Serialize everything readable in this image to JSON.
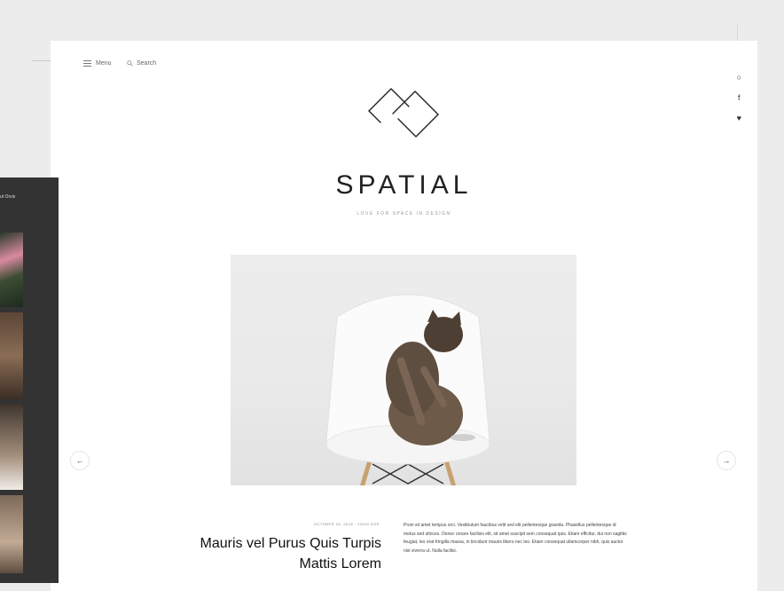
{
  "header": {
    "menu_label": "Menu",
    "search_label": "Search"
  },
  "social": {
    "items": [
      "github-icon",
      "facebook-icon",
      "twitter-icon"
    ],
    "glyphs": [
      "○",
      "f",
      "♥"
    ]
  },
  "brand": {
    "name": "SPATIAL",
    "tagline": "LOVE FOR SPACE IN DESIGN"
  },
  "slider": {
    "prev_glyph": "←",
    "next_glyph": "→"
  },
  "post": {
    "meta": "OCTOBER 16, 2018 · JOHN DOE",
    "title_line1": "Mauris vel Purus Quis Turpis",
    "title_line2": "Mattis Lorem",
    "body": "Proin sit amet tempus orci. Vestibulum faucibus velit sed elit pellentesque gravida. Phasellus pellentesque id metus sed ultrices. Donec ornare facilisis elit, sit amet suscipit sem consequat quis. Etiam efficitur, dui non sagittis feugiat, leo erat fringilla massa, in tincidunt mauris libero nec leo. Etiam consequat ullamcorper nibh, quis auctor nisl viverra ut. Nulla facilisi."
  },
  "side_panel": {
    "label": "ut Orvis"
  },
  "colors": {
    "background": "#ececec",
    "page": "#ffffff",
    "panel": "#333333",
    "text": "#222222"
  }
}
